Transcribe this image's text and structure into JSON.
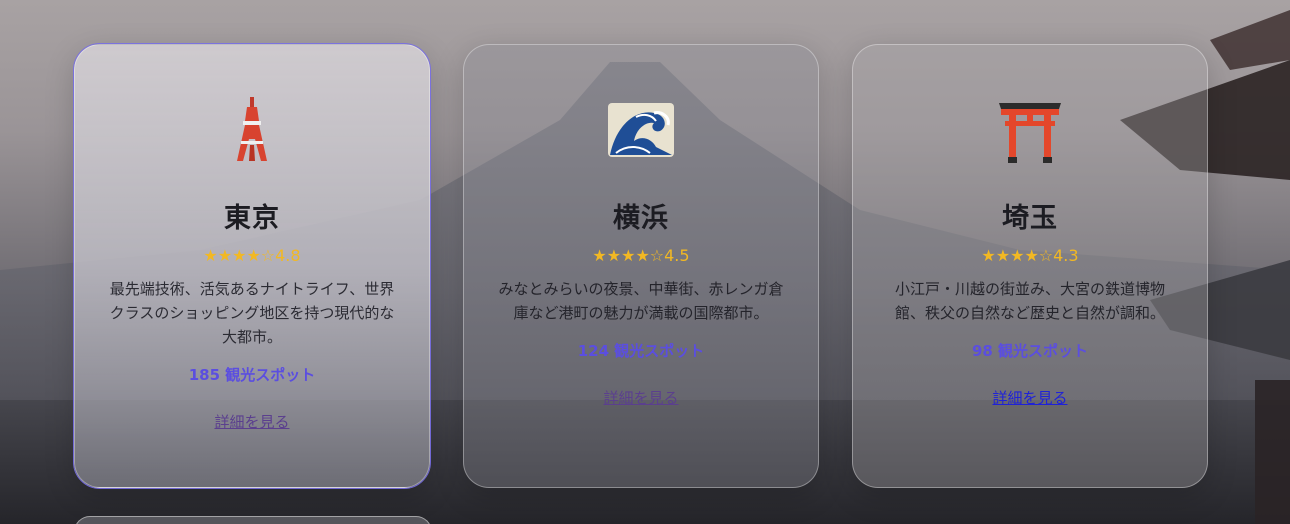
{
  "cards": [
    {
      "icon": "tokyo-tower-icon",
      "title": "東京",
      "rating_stars": "★★★★☆",
      "rating_value": "4.8",
      "description": "最先端技術、活気あるナイトライフ、世界クラスのショッピング地区を持つ現代的な大都市。",
      "spots": "185 観光スポット",
      "link": "詳細を見る"
    },
    {
      "icon": "great-wave-icon",
      "title": "横浜",
      "rating_stars": "★★★★☆",
      "rating_value": "4.5",
      "description": "みなとみらいの夜景、中華街、赤レンガ倉庫など港町の魅力が満載の国際都市。",
      "spots": "124 観光スポット",
      "link": "詳細を見る"
    },
    {
      "icon": "torii-gate-icon",
      "title": "埼玉",
      "rating_stars": "★★★★☆",
      "rating_value": "4.3",
      "description": "小江戸・川越の街並み、大宮の鉄道博物館、秩父の自然など歴史と自然が調和。",
      "spots": "98 観光スポット",
      "link": "詳細を見る"
    }
  ],
  "colors": {
    "star": "#f2b823",
    "spots": "#5b4ee0",
    "title": "#1c1c22"
  }
}
